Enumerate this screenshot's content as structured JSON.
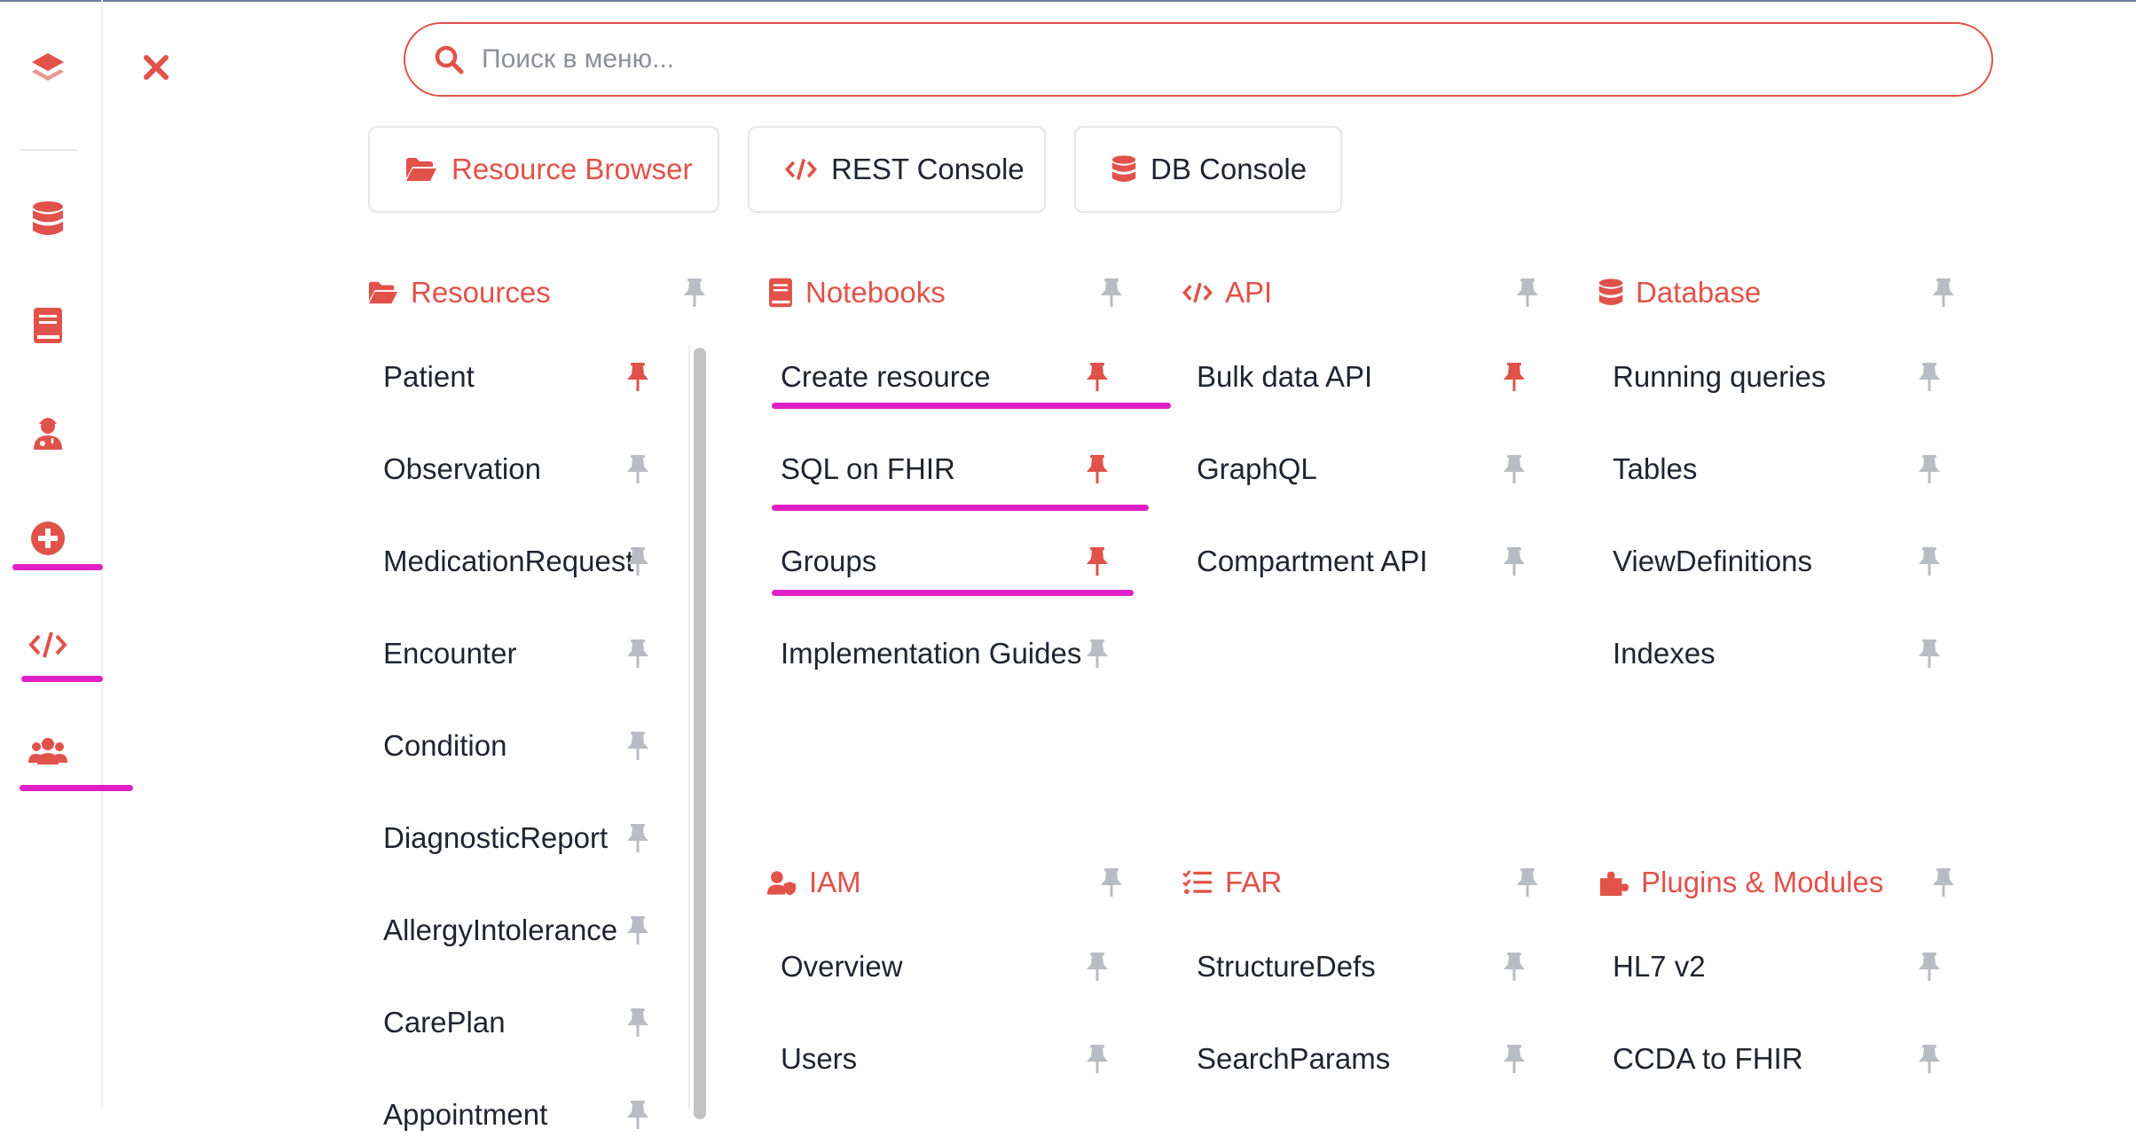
{
  "colors": {
    "accent": "#E1524A",
    "text": "#1f2430",
    "pin_inactive": "#b9bcc4",
    "highlight": "#E020C6"
  },
  "rail": {
    "items": [
      {
        "icon": "layers-icon"
      },
      {
        "icon": "database-icon"
      },
      {
        "icon": "notebook-icon"
      },
      {
        "icon": "user-doctor-icon"
      },
      {
        "icon": "plus-circle-icon"
      },
      {
        "icon": "code-icon"
      },
      {
        "icon": "users-icon"
      }
    ]
  },
  "search": {
    "placeholder": "Поиск в меню..."
  },
  "quick": [
    {
      "label": "Resource Browser",
      "icon": "folder-open-icon"
    },
    {
      "label": "REST Console",
      "icon": "code-icon"
    },
    {
      "label": "DB Console",
      "icon": "database-icon"
    }
  ],
  "sections": {
    "resources": {
      "title": "Resources",
      "items": [
        "Patient",
        "Observation",
        "MedicationRequest",
        "Encounter",
        "Condition",
        "DiagnosticReport",
        "AllergyIntolerance",
        "CarePlan",
        "Appointment"
      ],
      "pinned": [
        true,
        false,
        false,
        false,
        false,
        false,
        false,
        false,
        false
      ]
    },
    "notebooks": {
      "title": "Notebooks",
      "items": [
        "Create resource",
        "SQL on FHIR",
        "Groups",
        "Implementation Guides"
      ],
      "pinned": [
        true,
        true,
        true,
        false
      ]
    },
    "api": {
      "title": "API",
      "items": [
        "Bulk data API",
        "GraphQL",
        "Compartment API"
      ],
      "pinned": [
        true,
        false,
        false
      ]
    },
    "database": {
      "title": "Database",
      "items": [
        "Running queries",
        "Tables",
        "ViewDefinitions",
        "Indexes"
      ],
      "pinned": [
        false,
        false,
        false,
        false
      ]
    },
    "iam": {
      "title": "IAM",
      "items": [
        "Overview",
        "Users"
      ],
      "pinned": [
        false,
        false
      ]
    },
    "far": {
      "title": "FAR",
      "items": [
        "StructureDefs",
        "SearchParams"
      ],
      "pinned": [
        false,
        false
      ]
    },
    "plugins": {
      "title": "Plugins & Modules",
      "items": [
        "HL7 v2",
        "CCDA to FHIR"
      ],
      "pinned": [
        false,
        false
      ]
    }
  }
}
